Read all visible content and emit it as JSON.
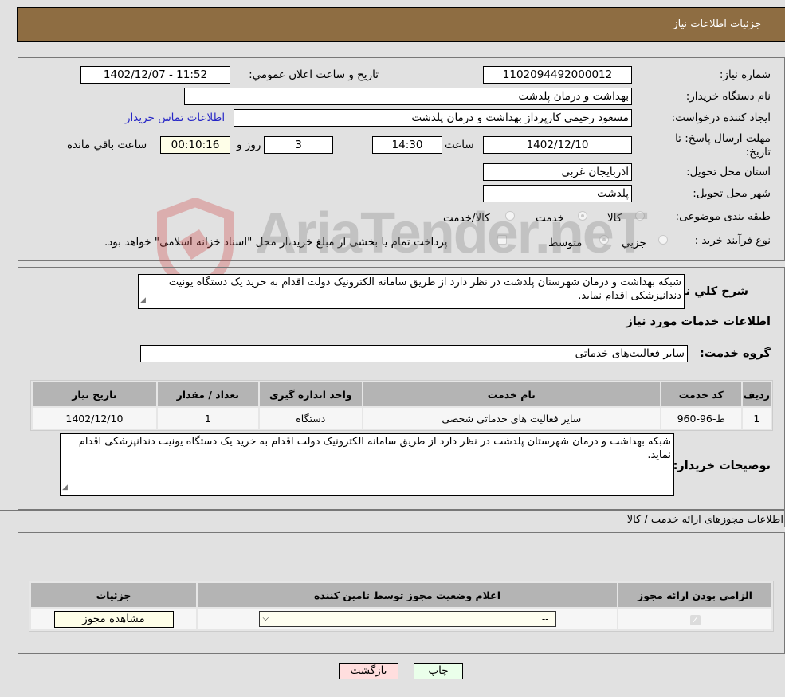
{
  "header": {
    "title": "جزئیات اطلاعات نیاز"
  },
  "form": {
    "need_number_label": "شماره نیاز:",
    "need_number": "1102094492000012",
    "announce_label": "تاریخ و ساعت اعلان عمومي:",
    "announce_value": "1402/12/07 - 11:52",
    "buyer_org_label": "نام دستگاه خریدار:",
    "buyer_org": "بهداشت و درمان پلدشت",
    "creator_label": "ایجاد کننده درخواست:",
    "creator": "مسعود رحیمی کارپرداز بهداشت و درمان پلدشت",
    "contact_link": "اطلاعات تماس خریدار",
    "deadline_label_1": "مهلت ارسال پاسخ: تا",
    "deadline_label_2": "تاریخ:",
    "deadline_date": "1402/12/10",
    "time_label": "ساعت",
    "deadline_time": "14:30",
    "days": "3",
    "days_label": "روز و",
    "remaining": "00:10:16",
    "remaining_label": "ساعت باقي مانده",
    "province_label": "استان محل تحویل:",
    "province": "آذربایجان غربی",
    "city_label": "شهر محل تحویل:",
    "city": "پلدشت",
    "category_label": "طبقه بندی موضوعی:",
    "category_options": [
      {
        "label": "کالا",
        "checked": false
      },
      {
        "label": "خدمت",
        "checked": true
      },
      {
        "label": "کالا/خدمت",
        "checked": false
      }
    ],
    "purchase_type_label": "نوع فرآیند خرید :",
    "purchase_options": [
      {
        "label": "جزيي",
        "checked": false
      },
      {
        "label": "متوسط",
        "checked": true
      }
    ],
    "treasury_note": "پرداخت تمام یا بخشی از مبلغ خرید،از محل \"اسناد خزانه اسلامی\" خواهد بود."
  },
  "description": {
    "label": "شرح کلي نیاز:",
    "text": "شبکه بهداشت و درمان شهرستان پلدشت در نظر دارد از طریق سامانه الکترونیک دولت اقدام به خرید یک دستگاه یونیت دندانپزشکی اقدام نماید."
  },
  "services": {
    "heading": "اطلاعات خدمات مورد نیاز",
    "group_label": "گروه خدمت:",
    "group_value": "سایر فعالیت‌های خدماتی",
    "columns": [
      "ردیف",
      "کد خدمت",
      "نام خدمت",
      "واحد اندازه گیری",
      "تعداد / مقدار",
      "تاریخ نیاز"
    ],
    "rows": [
      [
        "1",
        "ط-96-960",
        "سایر فعالیت های خدماتی شخصی",
        "دستگاه",
        "1",
        "1402/12/10"
      ]
    ]
  },
  "buyer_notes": {
    "label": "توضیحات خریدار:",
    "text": "شبکه بهداشت و درمان شهرستان پلدشت در نظر دارد از طریق سامانه الکترونیک دولت اقدام به خرید یک دستگاه یونیت دندانپزشکی اقدام نماید."
  },
  "permits": {
    "heading": "اطلاعات مجوزهای ارائه خدمت / کالا",
    "columns": [
      "الزامی بودن ارائه مجوز",
      "اعلام وضعیت مجوز توسط تامین کننده",
      "جزئیات"
    ],
    "row": {
      "required": true,
      "status_value": "--",
      "details_button": "مشاهده مجوز"
    }
  },
  "actions": {
    "print": "چاپ",
    "back": "بازگشت"
  },
  "watermark": {
    "text": "AriaTender.neT"
  }
}
